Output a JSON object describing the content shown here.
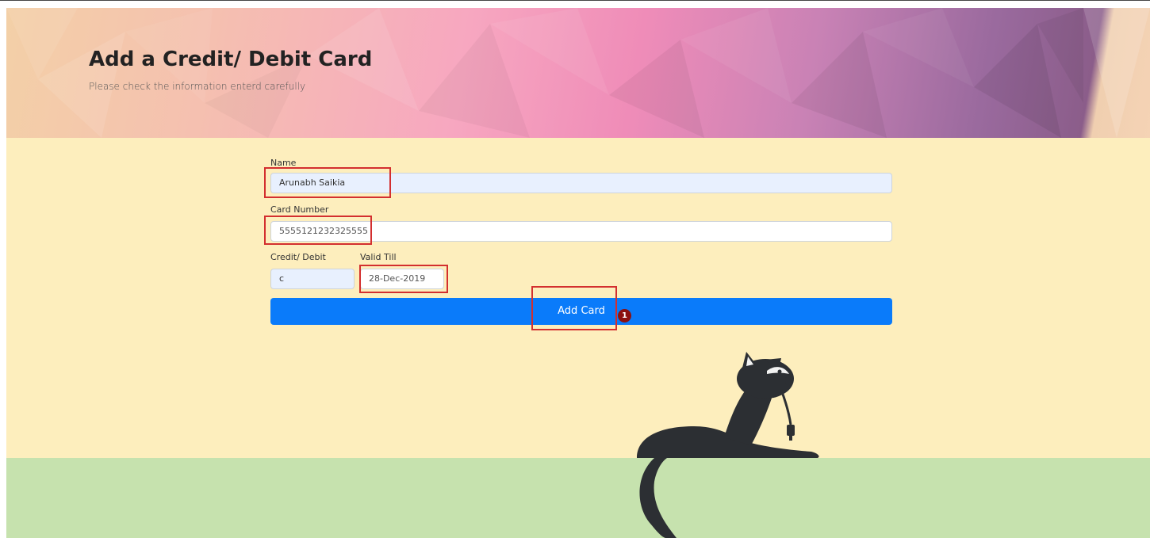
{
  "header": {
    "title": "Add a Credit/ Debit Card",
    "subtitle": "Please check the information enterd carefully"
  },
  "form": {
    "name": {
      "label": "Name",
      "value": "Arunabh Saikia"
    },
    "card_number": {
      "label": "Card Number",
      "value": "5555121232325555"
    },
    "card_type": {
      "label": "Credit/ Debit",
      "value": "c"
    },
    "valid_till": {
      "label": "Valid Till",
      "value": "28-Dec-2019"
    },
    "submit_label": "Add Card"
  },
  "annotations": {
    "step_badge": "1"
  },
  "decorations": {
    "illustration": "cat-with-cable-icon"
  },
  "colors": {
    "primary_button": "#0a7bfa",
    "content_background": "#fdeebd",
    "ground_background": "#c6e2ae",
    "highlight_border": "#d32f2f",
    "badge": "#8b1010",
    "autofill_background": "#e8f0fe"
  }
}
